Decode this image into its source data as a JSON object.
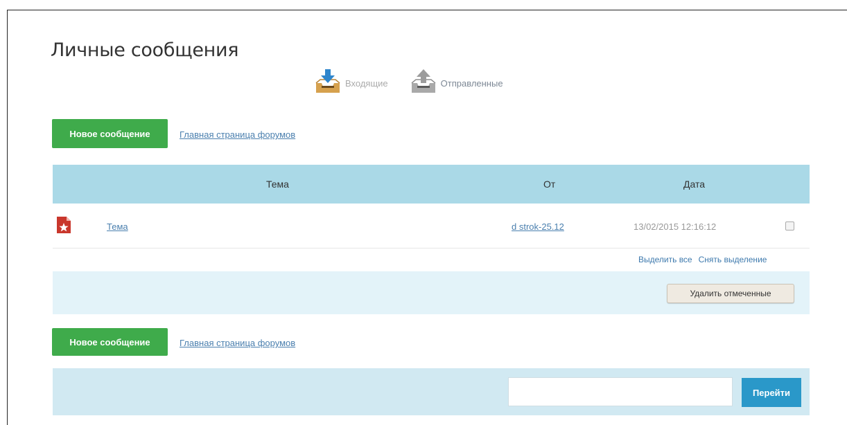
{
  "page": {
    "title": "Личные сообщения"
  },
  "folders": [
    {
      "label": "Входящие",
      "icon": "inbox-download-icon",
      "active": false
    },
    {
      "label": "Отправленные",
      "icon": "outbox-upload-icon",
      "active": true
    }
  ],
  "actions": {
    "new_message": "Новое сообщение",
    "forum_home": "Главная страница форумов"
  },
  "table": {
    "columns": [
      "Тема",
      "От",
      "Дата"
    ],
    "rows": [
      {
        "subject": "Тема",
        "from": "d strok-25.12",
        "date": "13/02/2015 12:16:12",
        "icon": "unread-star-icon",
        "checked": false
      }
    ]
  },
  "selection": {
    "select_all": "Выделить все",
    "deselect": "Снять выделение"
  },
  "delete_button": "Удалить отмеченные",
  "pagination": {
    "input_value": "",
    "go_button": "Перейти"
  },
  "colors": {
    "green": "#3fab4b",
    "header_blue": "#aad9e7",
    "light_blue": "#e3f3f9",
    "link": "#4a7fae",
    "go_button": "#2a98c9",
    "star_red": "#c9372c"
  }
}
